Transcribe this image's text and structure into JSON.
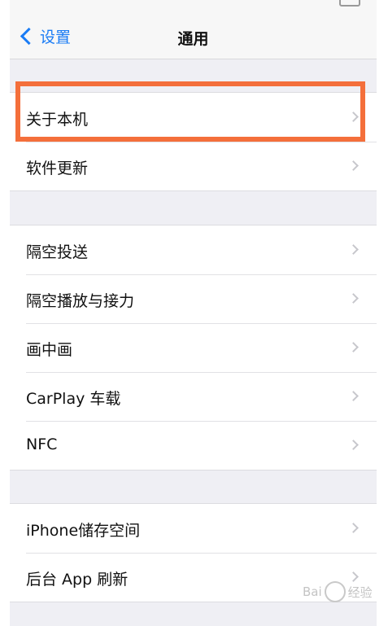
{
  "nav": {
    "back_label": "设置",
    "title": "通用"
  },
  "groups": [
    {
      "items": [
        {
          "label": "关于本机"
        },
        {
          "label": "软件更新"
        }
      ]
    },
    {
      "items": [
        {
          "label": "隔空投送"
        },
        {
          "label": "隔空播放与接力"
        },
        {
          "label": "画中画"
        },
        {
          "label": "CarPlay 车载"
        },
        {
          "label": "NFC"
        }
      ]
    },
    {
      "items": [
        {
          "label": "iPhone储存空间"
        },
        {
          "label": "后台 App 刷新"
        }
      ]
    }
  ],
  "watermark": {
    "text_left": "Bai",
    "text_right": "经验"
  },
  "colors": {
    "accent": "#1a7cf5",
    "highlight": "#f46f3b"
  },
  "icons": {
    "back": "chevron-left-icon",
    "disclosure": "chevron-right-icon"
  }
}
